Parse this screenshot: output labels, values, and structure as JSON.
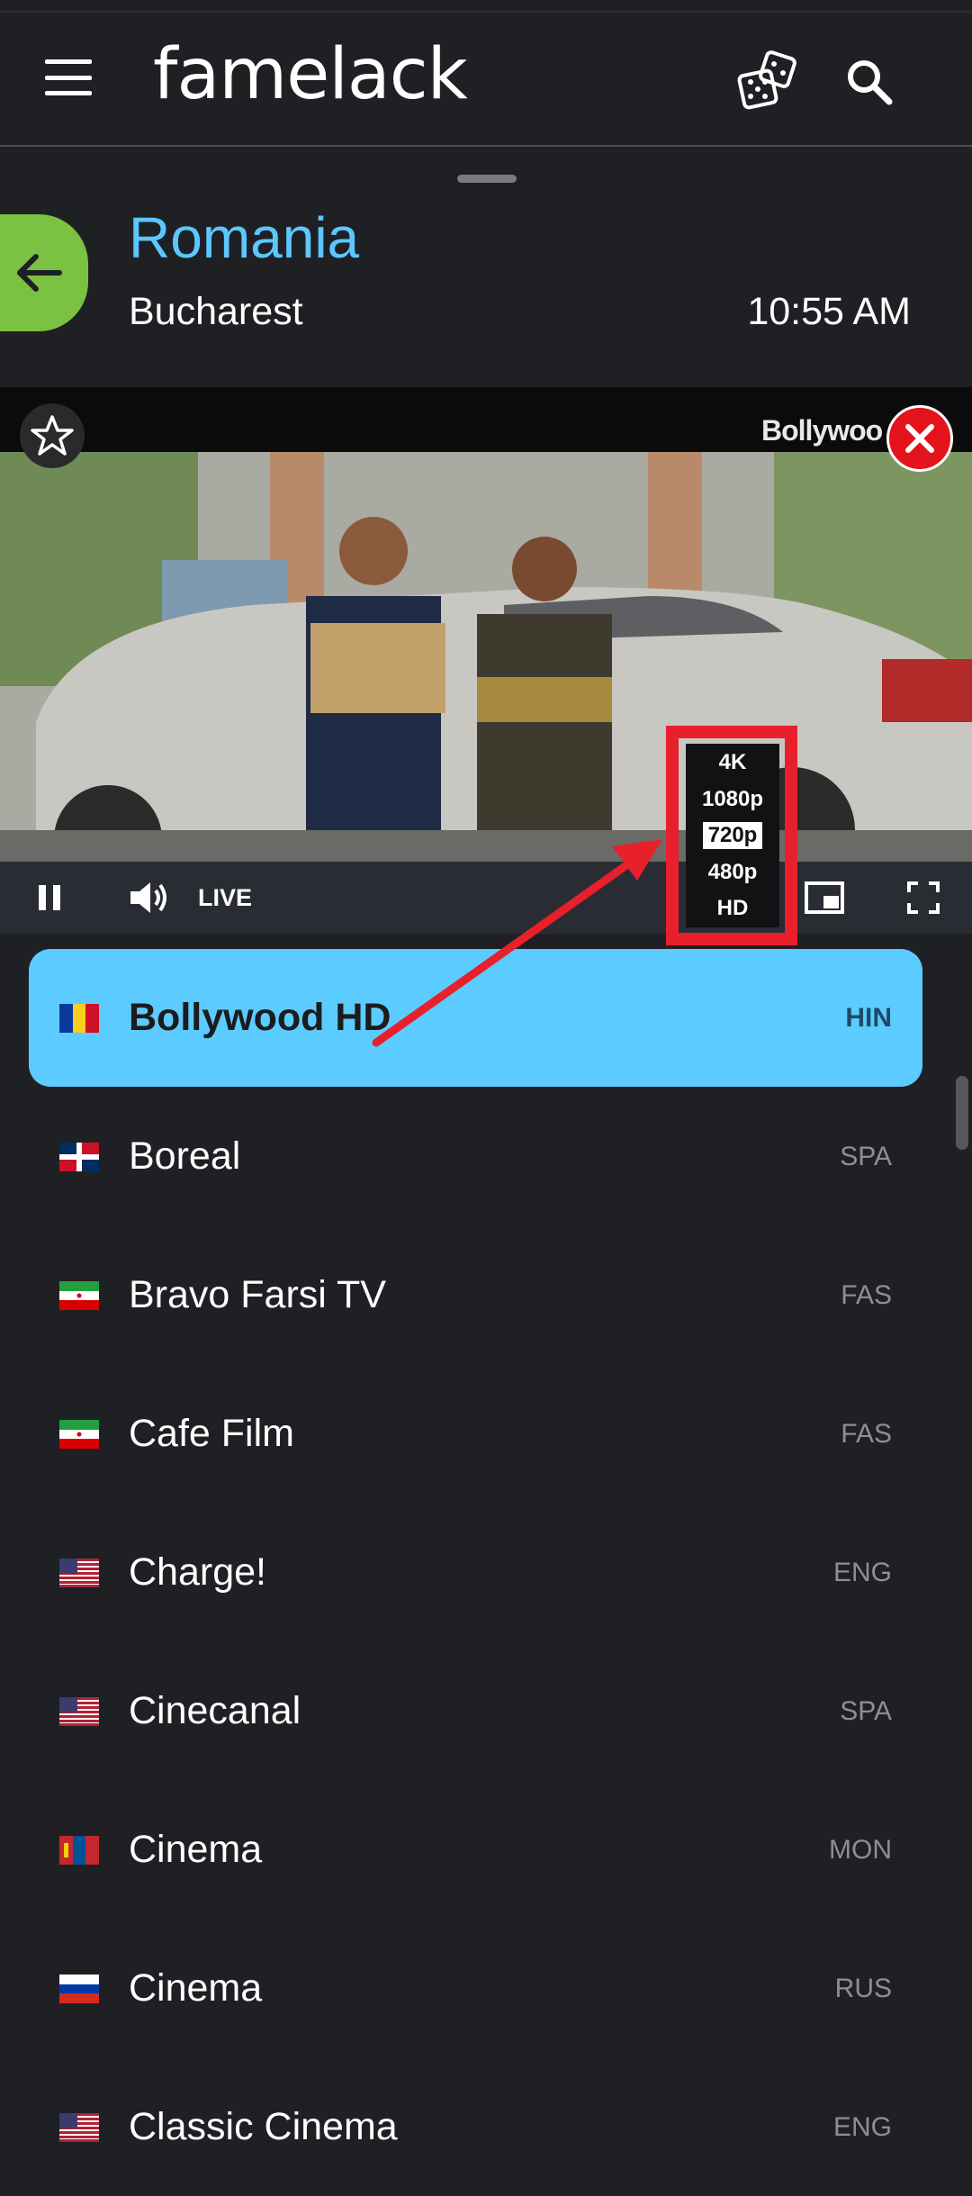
{
  "app": {
    "brand": "famelack"
  },
  "location": {
    "country": "Romania",
    "city": "Bucharest",
    "time": "10:55 AM"
  },
  "player": {
    "watermark": "Bollywoo",
    "live_label": "LIVE",
    "quality_options": [
      "4K",
      "1080p",
      "720p",
      "480p",
      "HD"
    ],
    "selected_quality": "720p"
  },
  "colors": {
    "accent_blue": "#5ccbff",
    "back_green": "#7cc242",
    "close_red": "#e3141c",
    "annotation_red": "#e8202b",
    "background": "#1f2024"
  },
  "icons": {
    "menu": "hamburger-menu-icon",
    "dice": "dice-icon",
    "search": "search-icon",
    "back": "arrow-left-icon",
    "favorite": "star-outline-icon",
    "close": "close-icon",
    "pause": "pause-icon",
    "volume": "volume-icon",
    "pip": "picture-in-picture-icon",
    "fullscreen": "fullscreen-icon"
  },
  "channels": [
    {
      "name": "Bollywood HD",
      "lang": "HIN",
      "flag": "romania",
      "active": true
    },
    {
      "name": "Boreal",
      "lang": "SPA",
      "flag": "dominican-republic",
      "active": false
    },
    {
      "name": "Bravo Farsi TV",
      "lang": "FAS",
      "flag": "iran",
      "active": false
    },
    {
      "name": "Cafe Film",
      "lang": "FAS",
      "flag": "iran",
      "active": false
    },
    {
      "name": "Charge!",
      "lang": "ENG",
      "flag": "usa",
      "active": false
    },
    {
      "name": "Cinecanal",
      "lang": "SPA",
      "flag": "usa",
      "active": false
    },
    {
      "name": "Cinema",
      "lang": "MON",
      "flag": "mongolia",
      "active": false
    },
    {
      "name": "Cinema",
      "lang": "RUS",
      "flag": "russia",
      "active": false
    },
    {
      "name": "Classic Cinema",
      "lang": "ENG",
      "flag": "usa",
      "active": false
    }
  ]
}
